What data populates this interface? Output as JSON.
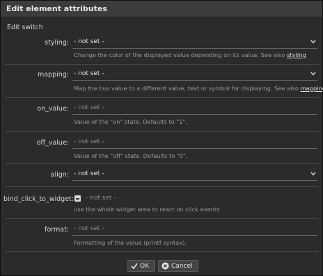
{
  "dialog": {
    "title": "Edit element attributes",
    "section": "Edit switch"
  },
  "fields": {
    "styling": {
      "label": "styling:",
      "value": "- not set -",
      "hint": "Change the color of the displayed value depending on its value. See also ",
      "link": "styling"
    },
    "mapping": {
      "label": "mapping:",
      "value": "- not set -",
      "hint": "Map the bus value to a different value, text or symbol for displaying. See also ",
      "link": "mapping"
    },
    "on_value": {
      "label": "on_value:",
      "placeholder": "- not set -",
      "hint": "Value of the \"on\" state. Defaults to \"1\"."
    },
    "off_value": {
      "label": "off_value:",
      "placeholder": "- not set -",
      "hint": "Value of the \"off\" state. Defaults to \"0\"."
    },
    "align": {
      "label": "align:",
      "value": "- not set -"
    },
    "bind_click_to_widget": {
      "label": "bind_click_to_widget:",
      "value": "- not set -",
      "hint": "use the whole widget area to react on click events"
    },
    "format": {
      "label": "format:",
      "placeholder": "- not set -",
      "hint": "Formatting of the value (printf syntax)."
    }
  },
  "buttons": {
    "ok": "OK",
    "cancel": "Cancel"
  },
  "icons": {
    "caret": "chevron-down-icon",
    "ok": "check-icon",
    "cancel": "close-circle-icon"
  }
}
